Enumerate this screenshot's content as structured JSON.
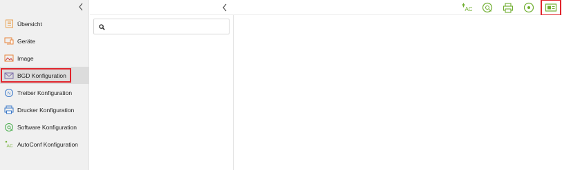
{
  "sidebar": {
    "collapse_icon": "chevron-left-icon",
    "items": [
      {
        "label": "Übersicht",
        "icon": "overview-icon",
        "active": false
      },
      {
        "label": "Geräte",
        "icon": "devices-icon",
        "active": false
      },
      {
        "label": "Image",
        "icon": "image-icon",
        "active": false
      },
      {
        "label": "BGD Konfiguration",
        "icon": "background-config-icon",
        "active": true
      },
      {
        "label": "Treiber Konfiguration",
        "icon": "driver-config-icon",
        "active": false
      },
      {
        "label": "Drucker Konfiguration",
        "icon": "printer-config-icon",
        "active": false
      },
      {
        "label": "Software Konfiguration",
        "icon": "software-config-icon",
        "active": false
      },
      {
        "label": "AutoConf Konfiguration",
        "icon": "autoconf-config-icon",
        "active": false
      }
    ]
  },
  "list_panel": {
    "collapse_icon": "chevron-left-icon",
    "search": {
      "placeholder": "",
      "value": "",
      "icon": "search-icon"
    }
  },
  "toolbar": {
    "buttons": [
      {
        "name": "autoconf-toolbar-icon",
        "text": "AC"
      },
      {
        "name": "software-toolbar-icon",
        "text": ""
      },
      {
        "name": "printer-toolbar-icon",
        "text": ""
      },
      {
        "name": "driver-toolbar-icon",
        "text": ""
      },
      {
        "name": "background-toolbar-icon",
        "text": "",
        "highlighted": true
      }
    ]
  },
  "colors": {
    "accent_green": "#6fae2f",
    "nav_orange": "#e8833a",
    "nav_blue": "#3a78c9",
    "nav_green": "#4caf50",
    "highlight_red": "#e0242c"
  }
}
